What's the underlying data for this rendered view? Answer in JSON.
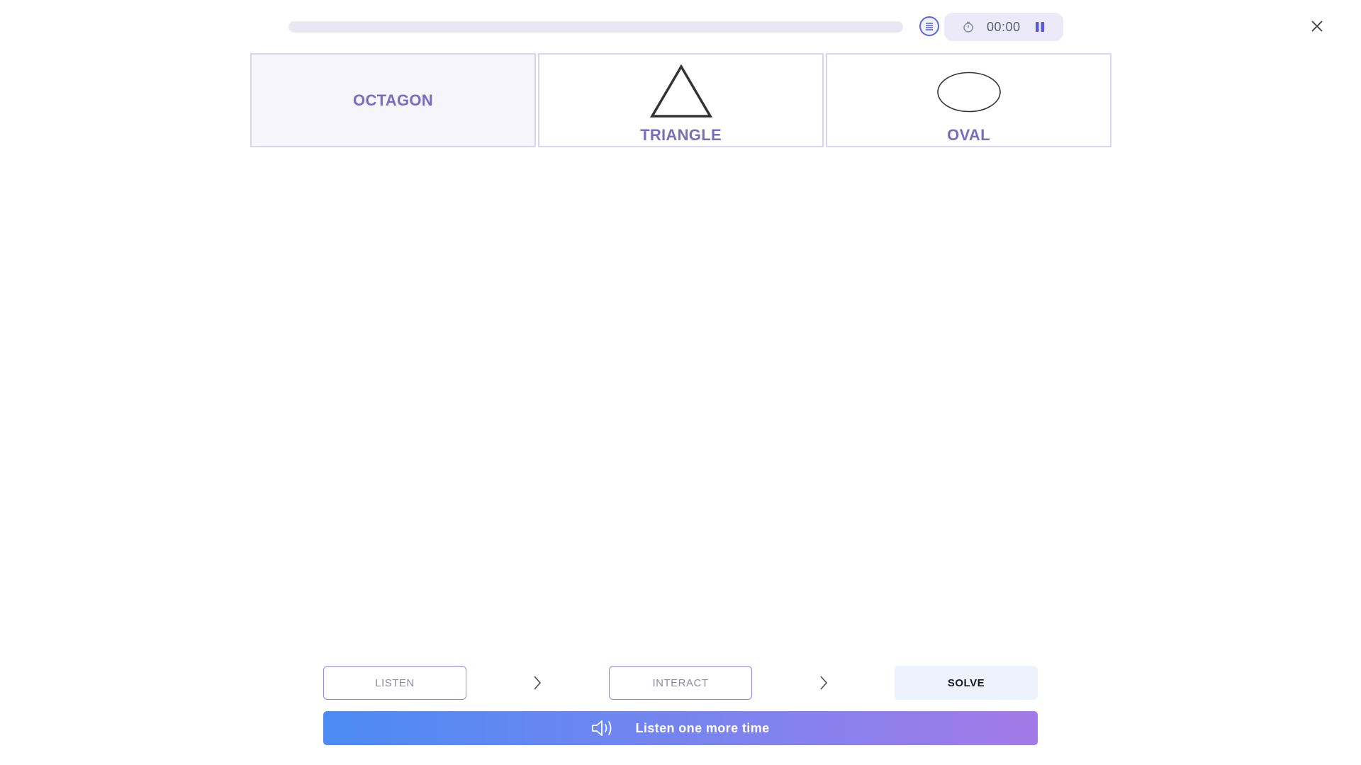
{
  "header": {
    "progress_percent": 0,
    "timer": "00:00",
    "icons": {
      "list": "list-icon",
      "timer": "stopwatch-icon",
      "pause": "pause-icon",
      "close": "close-icon"
    }
  },
  "cards": [
    {
      "label": "OCTAGON",
      "shape": "none",
      "selected": true
    },
    {
      "label": "TRIANGLE",
      "shape": "triangle",
      "selected": false
    },
    {
      "label": "OVAL",
      "shape": "oval",
      "selected": false
    }
  ],
  "steps": [
    {
      "label": "LISTEN",
      "active": false
    },
    {
      "label": "INTERACT",
      "active": false
    },
    {
      "label": "SOLVE",
      "active": true
    }
  ],
  "listen_button": {
    "label": "Listen one more time",
    "icon": "speaker-icon"
  },
  "colors": {
    "accent": "#7b6cc2",
    "card_border": "#d8d5ee",
    "gradient_start": "#4b8bf3",
    "gradient_end": "#a37ae8"
  }
}
